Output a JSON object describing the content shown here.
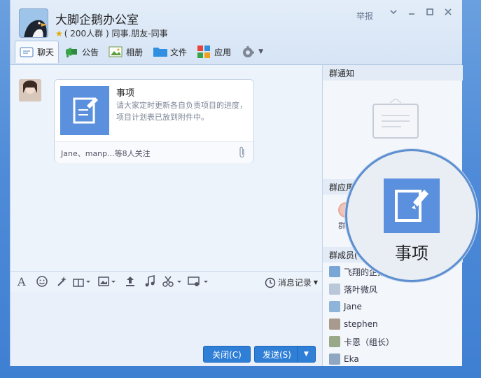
{
  "header": {
    "title": "大脚企鹅办公室",
    "subtitle": "( 200人群 ) 同事.朋友-同事",
    "report": "举报"
  },
  "tabs": [
    {
      "label": "聊天",
      "icon": "chat-icon"
    },
    {
      "label": "公告",
      "icon": "announcement-icon"
    },
    {
      "label": "相册",
      "icon": "album-icon"
    },
    {
      "label": "文件",
      "icon": "folder-icon"
    },
    {
      "label": "应用",
      "icon": "apps-icon"
    }
  ],
  "message": {
    "card_title": "事项",
    "card_desc": "请大家定时更新各自负责项目的进度，项目计划表已放到附件中。",
    "card_footer": "Jane、manp...等8人关注"
  },
  "toolbar": {
    "history": "消息记录"
  },
  "buttons": {
    "close": "关闭(C)",
    "send": "发送(S)"
  },
  "sidebar": {
    "notice_header": "群通知",
    "apps_header": "群应用",
    "app_item": "群视",
    "members_header": "群成员(",
    "members": [
      {
        "name": "飞翔的企鹅",
        "color": "#7aa6d6"
      },
      {
        "name": "落叶微风",
        "color": "#b9c7d8"
      },
      {
        "name": "Jane",
        "color": "#8fb4d9"
      },
      {
        "name": "stephen",
        "color": "#a89a8e"
      },
      {
        "name": "卡恩（组长）",
        "color": "#9aa88a"
      },
      {
        "name": "Eka",
        "color": "#8fa7c1"
      }
    ]
  },
  "zoom": {
    "label": "事项"
  },
  "colors": {
    "accent": "#2f7fd6",
    "icon_blue": "#5a90dd"
  }
}
